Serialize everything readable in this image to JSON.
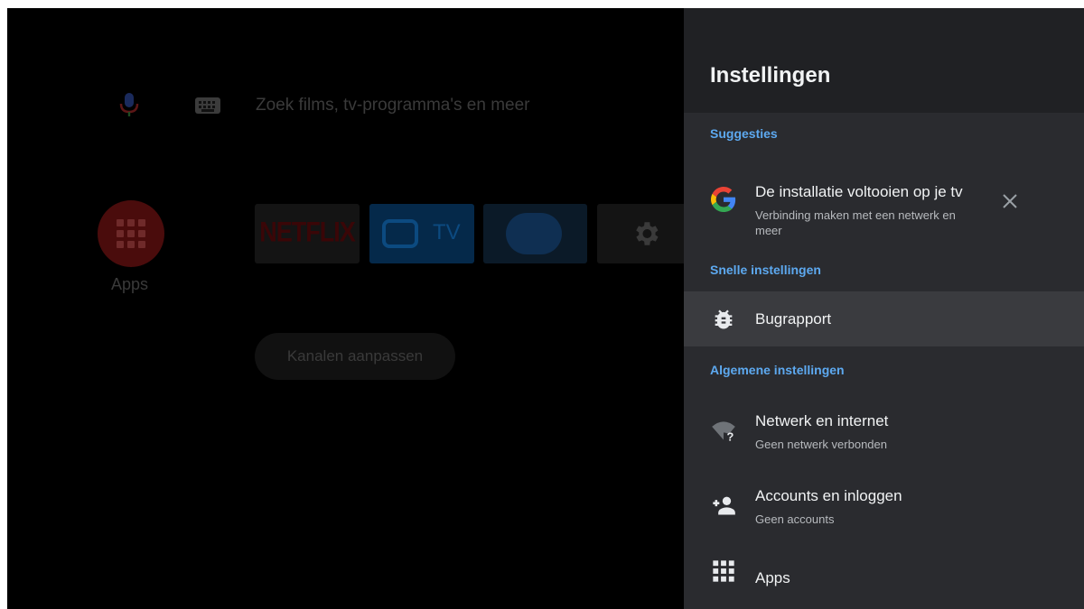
{
  "home": {
    "search_placeholder": "Zoek films, tv-programma's en meer",
    "apps_label": "Apps",
    "tiles": {
      "netflix": "NETFLIX",
      "tv": "TV"
    },
    "customize_channels": "Kanalen aanpassen",
    "icons": [
      "mic-icon",
      "keyboard-icon",
      "apps-grid-icon",
      "settings-gear-icon"
    ]
  },
  "panel": {
    "title": "Instellingen",
    "sections": {
      "suggestions": "Suggesties",
      "quick": "Snelle instellingen",
      "general": "Algemene instellingen"
    },
    "suggestion": {
      "title": "De installatie voltooien op je tv",
      "subtitle": "Verbinding maken met een netwerk en meer",
      "icon": "google-icon"
    },
    "bugreport": {
      "title": "Bugrapport",
      "icon": "bug-icon"
    },
    "network": {
      "title": "Netwerk en internet",
      "subtitle": "Geen netwerk verbonden",
      "icon": "wifi-question-icon"
    },
    "accounts": {
      "title": "Accounts en inloggen",
      "subtitle": "Geen accounts",
      "icon": "add-person-icon"
    },
    "apps": {
      "title": "Apps",
      "icon": "apps-grid-icon"
    }
  },
  "colors": {
    "accent": "#5da9f0",
    "panel_bg": "#202124",
    "panel_body_bg": "#2a2b2f",
    "selected_row_bg": "#3a3b3f"
  }
}
